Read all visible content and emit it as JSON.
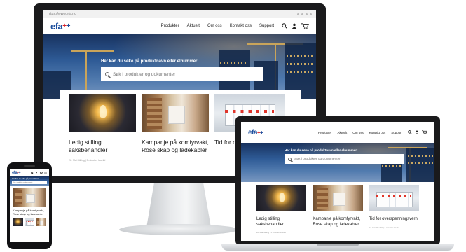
{
  "site": {
    "url": "https://www.efa.no",
    "logo_text": "efa",
    "nav": [
      "Produkter",
      "Aktuelt",
      "Om oss",
      "Kontakt oss",
      "Support"
    ],
    "hero_prompt": "Her kan du søke på produktnavn eller elnummer:",
    "search_placeholder": "Søk i produkter og dokumenter",
    "cards": [
      {
        "title": "Ledig stilling saksbehandler",
        "meta": "26. Mai Stilling | 5 minutter lesetid",
        "image": "lightbulb"
      },
      {
        "title": "Kampanje på komfyrvakt, Rose skap og ladekabler",
        "meta": "19. Mai Kampanje | 3 minutter lesetid",
        "image": "campaign-products"
      },
      {
        "title": "Tid for overspenningsvern",
        "meta": "12. Mai Produkt | 4 minutter lesetid",
        "image": "surge-protectors"
      }
    ]
  },
  "monitor": {
    "card3_title_cut": "Tid for overspen"
  },
  "phone": {
    "hero_prompt_short": "Her kan du søke på produktnavn",
    "card_title": "Kampanje på komfyrvakt, Rose skap og ladekabler"
  },
  "colors": {
    "brand_blue": "#1d4f9e",
    "brand_red": "#d8232a",
    "hero_blue": "#2e5a95"
  },
  "icons": [
    "search-icon",
    "user-icon",
    "cart-icon",
    "menu-dots-icon"
  ]
}
